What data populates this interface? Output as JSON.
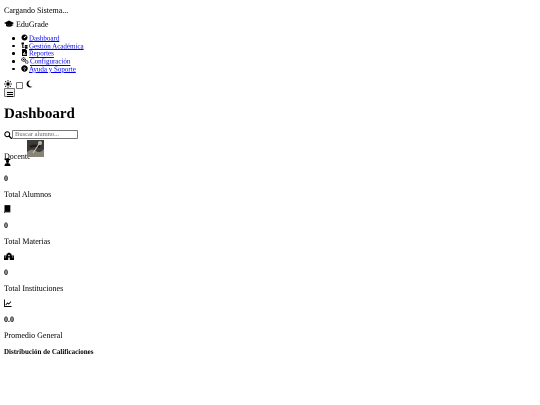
{
  "loading_text": "Cargando Sistema...",
  "brand": {
    "name": "EduGrade",
    "icon": "graduation-cap-icon"
  },
  "nav": {
    "items": [
      {
        "label": "Dashboard",
        "icon": "gauge-icon"
      },
      {
        "label": "Gestión Académica",
        "icon": "folder-tree-icon"
      },
      {
        "label": "Reportes",
        "icon": "file-chart-icon"
      },
      {
        "label": "Configuración",
        "icon": "gears-icon"
      },
      {
        "label": "Ayuda y Soporte",
        "icon": "question-circle-icon"
      }
    ]
  },
  "theme_toggle": {
    "light_icon": "sun-icon",
    "dark_icon": "moon-icon"
  },
  "menu_icon": "hamburger-icon",
  "page_title": "Dashboard",
  "search": {
    "placeholder": "Buscar alumno..."
  },
  "user": {
    "role": "Docente"
  },
  "stats": [
    {
      "icon": "user-graduate-icon",
      "value": "0",
      "label": "Total Alumnos"
    },
    {
      "icon": "book-icon",
      "value": "0",
      "label": "Total Materias"
    },
    {
      "icon": "school-icon",
      "value": "0",
      "label": "Total Instituciones"
    },
    {
      "icon": "chart-line-icon",
      "value": "0.0",
      "label": "Promedio General"
    }
  ],
  "section_title": "Distribución de Calificaciones"
}
